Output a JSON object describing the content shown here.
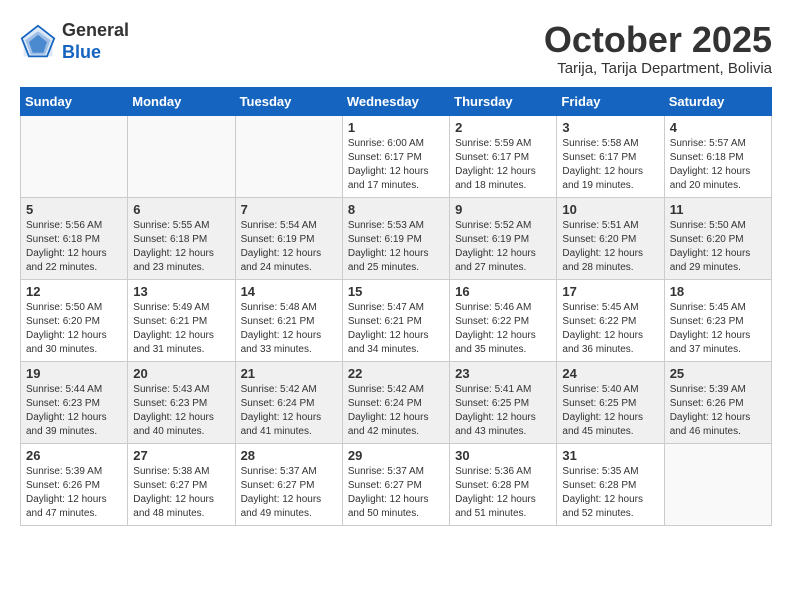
{
  "header": {
    "logo": {
      "line1": "General",
      "line2": "Blue"
    },
    "title": "October 2025",
    "subtitle": "Tarija, Tarija Department, Bolivia"
  },
  "weekdays": [
    "Sunday",
    "Monday",
    "Tuesday",
    "Wednesday",
    "Thursday",
    "Friday",
    "Saturday"
  ],
  "weeks": [
    [
      {
        "day": "",
        "info": ""
      },
      {
        "day": "",
        "info": ""
      },
      {
        "day": "",
        "info": ""
      },
      {
        "day": "1",
        "info": "Sunrise: 6:00 AM\nSunset: 6:17 PM\nDaylight: 12 hours\nand 17 minutes."
      },
      {
        "day": "2",
        "info": "Sunrise: 5:59 AM\nSunset: 6:17 PM\nDaylight: 12 hours\nand 18 minutes."
      },
      {
        "day": "3",
        "info": "Sunrise: 5:58 AM\nSunset: 6:17 PM\nDaylight: 12 hours\nand 19 minutes."
      },
      {
        "day": "4",
        "info": "Sunrise: 5:57 AM\nSunset: 6:18 PM\nDaylight: 12 hours\nand 20 minutes."
      }
    ],
    [
      {
        "day": "5",
        "info": "Sunrise: 5:56 AM\nSunset: 6:18 PM\nDaylight: 12 hours\nand 22 minutes."
      },
      {
        "day": "6",
        "info": "Sunrise: 5:55 AM\nSunset: 6:18 PM\nDaylight: 12 hours\nand 23 minutes."
      },
      {
        "day": "7",
        "info": "Sunrise: 5:54 AM\nSunset: 6:19 PM\nDaylight: 12 hours\nand 24 minutes."
      },
      {
        "day": "8",
        "info": "Sunrise: 5:53 AM\nSunset: 6:19 PM\nDaylight: 12 hours\nand 25 minutes."
      },
      {
        "day": "9",
        "info": "Sunrise: 5:52 AM\nSunset: 6:19 PM\nDaylight: 12 hours\nand 27 minutes."
      },
      {
        "day": "10",
        "info": "Sunrise: 5:51 AM\nSunset: 6:20 PM\nDaylight: 12 hours\nand 28 minutes."
      },
      {
        "day": "11",
        "info": "Sunrise: 5:50 AM\nSunset: 6:20 PM\nDaylight: 12 hours\nand 29 minutes."
      }
    ],
    [
      {
        "day": "12",
        "info": "Sunrise: 5:50 AM\nSunset: 6:20 PM\nDaylight: 12 hours\nand 30 minutes."
      },
      {
        "day": "13",
        "info": "Sunrise: 5:49 AM\nSunset: 6:21 PM\nDaylight: 12 hours\nand 31 minutes."
      },
      {
        "day": "14",
        "info": "Sunrise: 5:48 AM\nSunset: 6:21 PM\nDaylight: 12 hours\nand 33 minutes."
      },
      {
        "day": "15",
        "info": "Sunrise: 5:47 AM\nSunset: 6:21 PM\nDaylight: 12 hours\nand 34 minutes."
      },
      {
        "day": "16",
        "info": "Sunrise: 5:46 AM\nSunset: 6:22 PM\nDaylight: 12 hours\nand 35 minutes."
      },
      {
        "day": "17",
        "info": "Sunrise: 5:45 AM\nSunset: 6:22 PM\nDaylight: 12 hours\nand 36 minutes."
      },
      {
        "day": "18",
        "info": "Sunrise: 5:45 AM\nSunset: 6:23 PM\nDaylight: 12 hours\nand 37 minutes."
      }
    ],
    [
      {
        "day": "19",
        "info": "Sunrise: 5:44 AM\nSunset: 6:23 PM\nDaylight: 12 hours\nand 39 minutes."
      },
      {
        "day": "20",
        "info": "Sunrise: 5:43 AM\nSunset: 6:23 PM\nDaylight: 12 hours\nand 40 minutes."
      },
      {
        "day": "21",
        "info": "Sunrise: 5:42 AM\nSunset: 6:24 PM\nDaylight: 12 hours\nand 41 minutes."
      },
      {
        "day": "22",
        "info": "Sunrise: 5:42 AM\nSunset: 6:24 PM\nDaylight: 12 hours\nand 42 minutes."
      },
      {
        "day": "23",
        "info": "Sunrise: 5:41 AM\nSunset: 6:25 PM\nDaylight: 12 hours\nand 43 minutes."
      },
      {
        "day": "24",
        "info": "Sunrise: 5:40 AM\nSunset: 6:25 PM\nDaylight: 12 hours\nand 45 minutes."
      },
      {
        "day": "25",
        "info": "Sunrise: 5:39 AM\nSunset: 6:26 PM\nDaylight: 12 hours\nand 46 minutes."
      }
    ],
    [
      {
        "day": "26",
        "info": "Sunrise: 5:39 AM\nSunset: 6:26 PM\nDaylight: 12 hours\nand 47 minutes."
      },
      {
        "day": "27",
        "info": "Sunrise: 5:38 AM\nSunset: 6:27 PM\nDaylight: 12 hours\nand 48 minutes."
      },
      {
        "day": "28",
        "info": "Sunrise: 5:37 AM\nSunset: 6:27 PM\nDaylight: 12 hours\nand 49 minutes."
      },
      {
        "day": "29",
        "info": "Sunrise: 5:37 AM\nSunset: 6:27 PM\nDaylight: 12 hours\nand 50 minutes."
      },
      {
        "day": "30",
        "info": "Sunrise: 5:36 AM\nSunset: 6:28 PM\nDaylight: 12 hours\nand 51 minutes."
      },
      {
        "day": "31",
        "info": "Sunrise: 5:35 AM\nSunset: 6:28 PM\nDaylight: 12 hours\nand 52 minutes."
      },
      {
        "day": "",
        "info": ""
      }
    ]
  ]
}
